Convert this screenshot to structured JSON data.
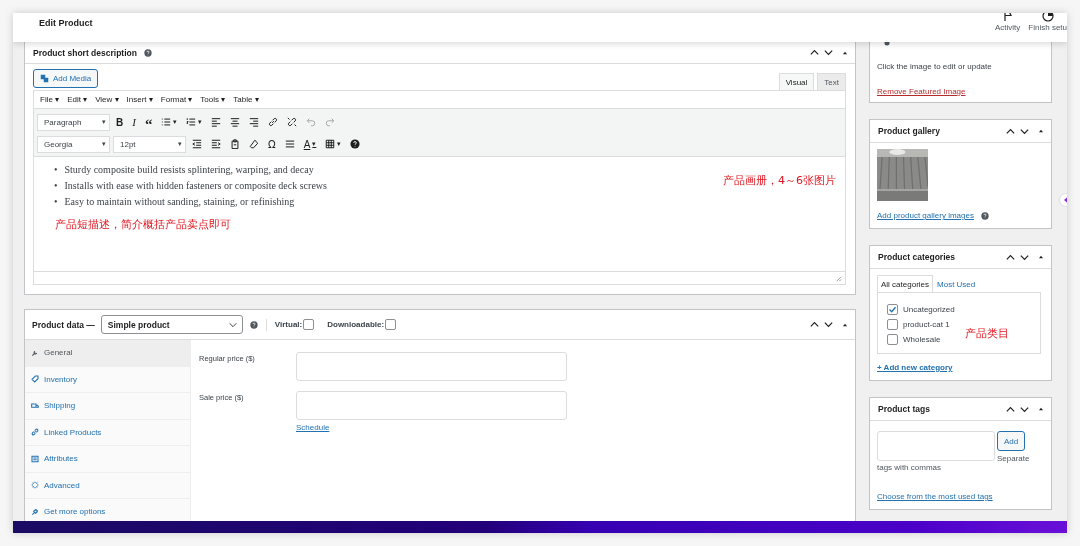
{
  "header": {
    "title": "Edit Product",
    "actions": [
      {
        "kind": "flag",
        "label": "Activity"
      },
      {
        "kind": "progress",
        "label": "Finish setu"
      }
    ]
  },
  "short_description": {
    "title": "Product short description",
    "add_media": "Add Media",
    "editor_tabs": [
      {
        "label": "Visual",
        "selected": true
      },
      {
        "label": "Text",
        "selected": false
      }
    ],
    "menus": [
      {
        "label": "File",
        "caret": "▾"
      },
      {
        "label": "Edit",
        "caret": "▾"
      },
      {
        "label": "View",
        "caret": "▾"
      },
      {
        "label": "Insert",
        "caret": "▾"
      },
      {
        "label": "Format",
        "caret": "▾"
      },
      {
        "label": "Tools",
        "caret": "▾"
      },
      {
        "label": "Table",
        "caret": "▾"
      }
    ],
    "toolbar_1": [
      {
        "kind": "select",
        "text": "Paragraph",
        "caret": "▾"
      },
      {
        "kind": "bold",
        "text": "B",
        "disabled": false
      },
      {
        "kind": "italic",
        "text": "I",
        "disabled": false
      },
      {
        "kind": "quote",
        "text": "“",
        "disabled": false
      },
      {
        "kind": "icon",
        "caret": "▾",
        "disabled": false
      },
      {
        "kind": "icon",
        "caret": "▾",
        "disabled": false
      },
      {
        "kind": "icon",
        "disabled": false
      },
      {
        "kind": "icon",
        "disabled": false
      },
      {
        "kind": "icon",
        "disabled": false
      },
      {
        "kind": "icon",
        "disabled": false
      },
      {
        "kind": "icon",
        "disabled": false
      },
      {
        "kind": "icon",
        "disabled": true
      },
      {
        "kind": "icon",
        "disabled": true
      }
    ],
    "toolbar_2": [
      {
        "kind": "select",
        "text": "Georgia",
        "caret": "▾"
      },
      {
        "kind": "select",
        "text": "12pt",
        "caret": "▾"
      },
      {
        "kind": "icon",
        "disabled": false
      },
      {
        "kind": "icon",
        "disabled": false
      },
      {
        "kind": "icon",
        "disabled": false
      },
      {
        "kind": "icon",
        "disabled": false
      },
      {
        "kind": "glyph",
        "text": "Ω",
        "disabled": false
      },
      {
        "kind": "icon",
        "disabled": false
      },
      {
        "kind": "underline",
        "text": "A",
        "caret": "▾",
        "disabled": false
      },
      {
        "kind": "icon",
        "caret": "▾",
        "disabled": false
      },
      {
        "kind": "help",
        "disabled": false
      }
    ],
    "bullets": [
      {
        "marker": "•",
        "text": "Sturdy composite build resists splintering, warping, and decay"
      },
      {
        "marker": "•",
        "text": "Installs with ease with hidden fasteners or composite deck screws"
      },
      {
        "marker": "•",
        "text": "Easy to maintain without sanding, staining, or refinishing"
      }
    ],
    "annotation": "产品短描述，简介概括产品卖点即可",
    "side_annotation": "产品画册，4～6张图片"
  },
  "product_data": {
    "title": "Product data —",
    "type": "Simple product",
    "options": [
      {
        "label": "Virtual:",
        "checked": false
      },
      {
        "label": "Downloadable:",
        "checked": false
      }
    ],
    "tabs": [
      {
        "label": "General",
        "selected": true
      },
      {
        "label": "Inventory",
        "selected": false
      },
      {
        "label": "Shipping",
        "selected": false
      },
      {
        "label": "Linked Products",
        "selected": false
      },
      {
        "label": "Attributes",
        "selected": false
      },
      {
        "label": "Advanced",
        "selected": false
      },
      {
        "label": "Get more options",
        "selected": false
      }
    ],
    "fields": [
      {
        "label": "Regular price ($)"
      },
      {
        "label": "Sale price ($)",
        "link": "Schedule"
      }
    ]
  },
  "featured_image": {
    "hint": "Click the image to edit or update",
    "remove_link": "Remove Featured Image"
  },
  "gallery": {
    "title": "Product gallery",
    "add_link": "Add product gallery images"
  },
  "categories": {
    "title": "Product categories",
    "tabs": [
      {
        "label": "All categories",
        "selected": true
      },
      {
        "label": "Most Used",
        "selected": false
      }
    ],
    "items": [
      {
        "label": "Uncategorized",
        "checked": true
      },
      {
        "label": "product-cat 1",
        "checked": false
      },
      {
        "label": "Wholesale",
        "checked": false
      }
    ],
    "annotation": "产品类目",
    "add_link": "+ Add new category"
  },
  "tags": {
    "title": "Product tags",
    "add_button": "Add",
    "hint_1": "Separate",
    "hint_2": "tags with commas",
    "choose_link": "Choose from the most used tags"
  }
}
